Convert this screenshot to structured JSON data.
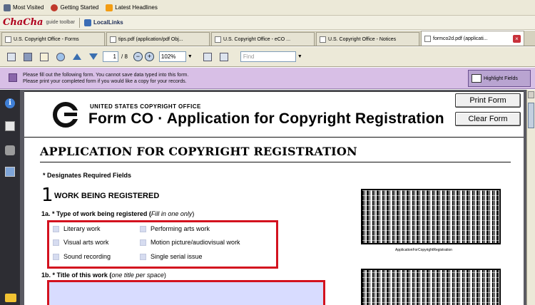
{
  "bookmarks": [
    {
      "label": "Most Visited",
      "color": "#5b6b89"
    },
    {
      "label": "Getting Started",
      "color": "#c0392b"
    },
    {
      "label": "Latest Headlines",
      "color": "#f39c12"
    }
  ],
  "toolbar2": {
    "brand": "ChaCha",
    "guide": "guide toolbar",
    "locallinks": "LocalLinks"
  },
  "tabs": [
    {
      "label": "U.S. Copyright Office - Forms",
      "active": false
    },
    {
      "label": "tips.pdf (application/pdf Obj...",
      "active": false
    },
    {
      "label": "U.S. Copyright Office - eCO ...",
      "active": false
    },
    {
      "label": "U.S. Copyright Office - Notices",
      "active": false
    },
    {
      "label": "formco2d.pdf (applicati...",
      "active": true
    }
  ],
  "pdfbar": {
    "page": "1",
    "total": "/ 8",
    "zoom": "102%",
    "find_placeholder": "Find"
  },
  "notice": {
    "line1": "Please fill out the following form. You cannot save data typed into this form.",
    "line2": "Please print your completed form if you would like a copy for your records.",
    "highlight": "Highlight Fields"
  },
  "form": {
    "office": "UNITED STATES COPYRIGHT OFFICE",
    "title": "Form CO · Application for Copyright Registration",
    "print": "Print Form",
    "clear": "Clear Form",
    "heading": "APPLICATION FOR COPYRIGHT REGISTRATION",
    "required": "* Designates Required Fields",
    "section_num": "1",
    "section_title": "WORK BEING REGISTERED",
    "q1a_prefix": "1a. * Type of work being registered (",
    "q1a_hint": "Fill in one only",
    "q1a_suffix": ")",
    "options": [
      "Literary work",
      "Performing arts work",
      "Visual arts work",
      "Motion picture/audiovisual work",
      "Sound recording",
      "Single serial issue"
    ],
    "q1b_prefix": "1b. * Title of this work (",
    "q1b_hint": "one title per space",
    "q1b_suffix": ")",
    "barcode_label": "ApplicationForCopyrightRegistration"
  }
}
